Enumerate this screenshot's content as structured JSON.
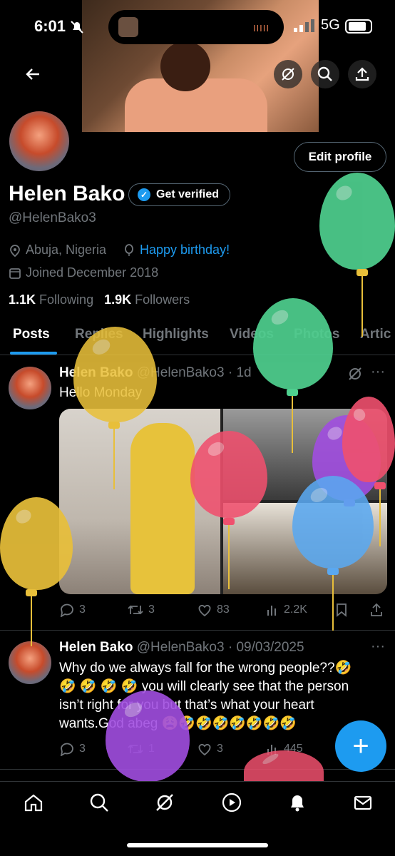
{
  "status_bar": {
    "time": "6:01",
    "network": "5G",
    "activity": "IIIII"
  },
  "profile": {
    "name": "Helen Bako",
    "handle": "@HelenBako3",
    "verify_label": "Get verified",
    "edit_label": "Edit profile",
    "location": "Abuja, Nigeria",
    "birthday_link": "Happy birthday!",
    "joined": "Joined December 2018",
    "following_count": "1.1K",
    "following_label": "Following",
    "followers_count": "1.9K",
    "followers_label": "Followers"
  },
  "tabs": [
    "Posts",
    "Replies",
    "Highlights",
    "Videos",
    "Photos",
    "Artic"
  ],
  "posts": [
    {
      "name": "Helen Bako",
      "handle": "@HelenBako3",
      "sep": "·",
      "time": "1d",
      "text": "Hello Monday",
      "replies": "3",
      "reposts": "3",
      "likes": "83",
      "views": "2.2K"
    },
    {
      "name": "Helen Bako",
      "handle": "@HelenBako3",
      "sep": "·",
      "time": "09/03/2025",
      "text_line1": "Why do we always fall for the wrong people??🤣",
      "text_line2": "🤣 🤣 🤣 🤣 you will clearly see that the person",
      "text_line3": "isn’t right for you but that’s what your heart",
      "text_line4": "wants.God abeg 😩🤣🤣🤣🤣🤣🤣🤣",
      "replies": "3",
      "reposts": "1",
      "likes": "3",
      "views": "445"
    }
  ],
  "fab_label": "+",
  "balloon_colors": {
    "green": "#4fd08f",
    "yellow": "#e8bf3a",
    "pink": "#f0506e",
    "purple": "#a14ee0",
    "blue": "#5aa8f0",
    "accent": "#1d9bf0"
  }
}
